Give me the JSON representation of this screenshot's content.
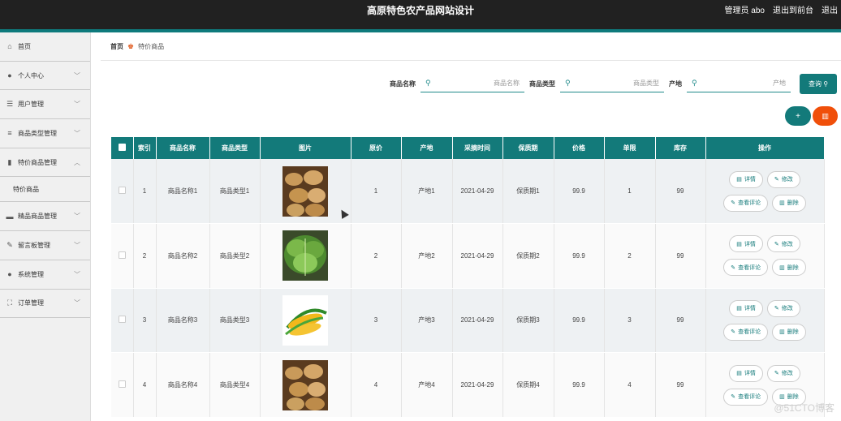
{
  "header": {
    "title": "高原特色农产品网站设计",
    "admin": "管理员 abo",
    "to_front": "退出到前台",
    "logout": "退出"
  },
  "sidebar": {
    "items": [
      {
        "label": "首页",
        "icon": "home-icon",
        "glyph": "⌂"
      },
      {
        "label": "个人中心",
        "icon": "user-icon",
        "glyph": "●"
      },
      {
        "label": "用户管理",
        "icon": "list-icon",
        "glyph": "☰"
      },
      {
        "label": "商品类型管理",
        "icon": "sliders-icon",
        "glyph": "≡"
      },
      {
        "label": "特价商品管理",
        "icon": "bar-chart-icon",
        "glyph": "▮"
      },
      {
        "label": "精品商品管理",
        "icon": "goods-icon",
        "glyph": "▬"
      },
      {
        "label": "留言板管理",
        "icon": "message-icon",
        "glyph": "✎"
      },
      {
        "label": "系统管理",
        "icon": "system-icon",
        "glyph": "●"
      },
      {
        "label": "订单管理",
        "icon": "order-icon",
        "glyph": "⛶"
      }
    ],
    "sub_item": "特价商品"
  },
  "breadcrumb": {
    "home": "首页",
    "current": "特价商品"
  },
  "search": {
    "name_label": "商品名称",
    "name_placeholder": "商品名称",
    "type_label": "商品类型",
    "type_placeholder": "商品类型",
    "origin_label": "产地",
    "origin_placeholder": "产地",
    "button": "查询"
  },
  "actions": {
    "add": "+",
    "delete": "🗑"
  },
  "table": {
    "headers": [
      "索引",
      "商品名称",
      "商品类型",
      "图片",
      "原价",
      "产地",
      "采摘时间",
      "保质期",
      "价格",
      "单限",
      "库存",
      "操作"
    ],
    "rows": [
      {
        "index": "1",
        "name": "商品名称1",
        "type": "商品类型1",
        "pic": "potato",
        "orig": "1",
        "origin": "产地1",
        "date": "2021-04-29",
        "shelf": "保质期1",
        "price": "99.9",
        "limit": "1",
        "stock": "99"
      },
      {
        "index": "2",
        "name": "商品名称2",
        "type": "商品类型2",
        "pic": "lettuce",
        "orig": "2",
        "origin": "产地2",
        "date": "2021-04-29",
        "shelf": "保质期2",
        "price": "99.9",
        "limit": "2",
        "stock": "99"
      },
      {
        "index": "3",
        "name": "商品名称3",
        "type": "商品类型3",
        "pic": "corn",
        "orig": "3",
        "origin": "产地3",
        "date": "2021-04-29",
        "shelf": "保质期3",
        "price": "99.9",
        "limit": "3",
        "stock": "99"
      },
      {
        "index": "4",
        "name": "商品名称4",
        "type": "商品类型4",
        "pic": "potato",
        "orig": "4",
        "origin": "产地4",
        "date": "2021-04-29",
        "shelf": "保质期4",
        "price": "99.9",
        "limit": "4",
        "stock": "99"
      }
    ],
    "ops": {
      "detail": "详情",
      "edit": "修改",
      "comments": "查看评论",
      "delete": "删除"
    }
  },
  "watermark": "@51CTO博客",
  "colors": {
    "teal": "#137a7a",
    "orange": "#f04f0a",
    "header_bg": "#212121"
  }
}
